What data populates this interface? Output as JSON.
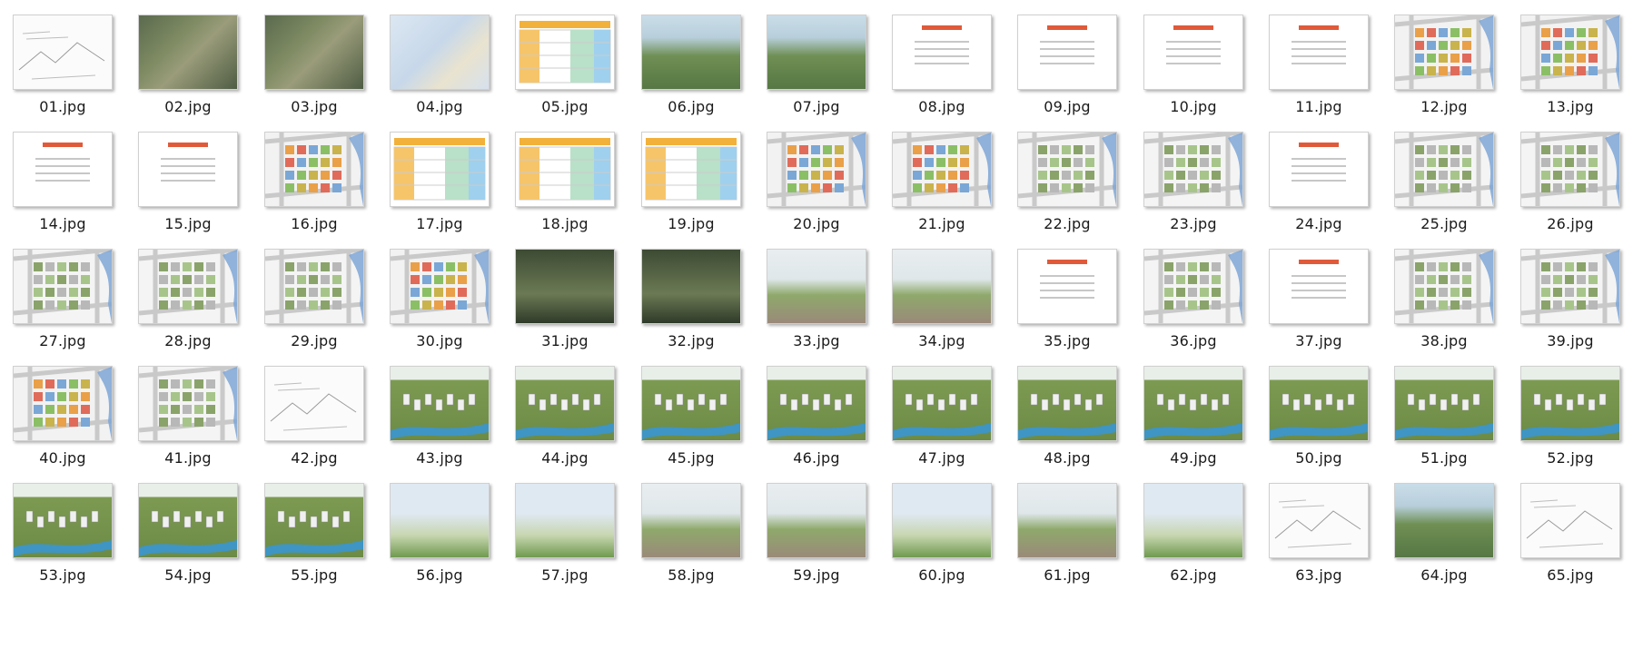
{
  "files": [
    {
      "name": "01.jpg",
      "kind": "sketch"
    },
    {
      "name": "02.jpg",
      "kind": "aerial"
    },
    {
      "name": "03.jpg",
      "kind": "aerial"
    },
    {
      "name": "04.jpg",
      "kind": "map"
    },
    {
      "name": "05.jpg",
      "kind": "table"
    },
    {
      "name": "06.jpg",
      "kind": "render"
    },
    {
      "name": "07.jpg",
      "kind": "render"
    },
    {
      "name": "08.jpg",
      "kind": "text"
    },
    {
      "name": "09.jpg",
      "kind": "text"
    },
    {
      "name": "10.jpg",
      "kind": "text"
    },
    {
      "name": "11.jpg",
      "kind": "text"
    },
    {
      "name": "12.jpg",
      "kind": "plan-color"
    },
    {
      "name": "13.jpg",
      "kind": "plan-color"
    },
    {
      "name": "14.jpg",
      "kind": "text"
    },
    {
      "name": "15.jpg",
      "kind": "text"
    },
    {
      "name": "16.jpg",
      "kind": "plan-color"
    },
    {
      "name": "17.jpg",
      "kind": "table"
    },
    {
      "name": "18.jpg",
      "kind": "table"
    },
    {
      "name": "19.jpg",
      "kind": "table"
    },
    {
      "name": "20.jpg",
      "kind": "plan-color"
    },
    {
      "name": "21.jpg",
      "kind": "plan-color"
    },
    {
      "name": "22.jpg",
      "kind": "plan"
    },
    {
      "name": "23.jpg",
      "kind": "plan"
    },
    {
      "name": "24.jpg",
      "kind": "text"
    },
    {
      "name": "25.jpg",
      "kind": "plan"
    },
    {
      "name": "26.jpg",
      "kind": "plan"
    },
    {
      "name": "27.jpg",
      "kind": "plan"
    },
    {
      "name": "28.jpg",
      "kind": "plan"
    },
    {
      "name": "29.jpg",
      "kind": "plan"
    },
    {
      "name": "30.jpg",
      "kind": "plan-color"
    },
    {
      "name": "31.jpg",
      "kind": "photo-dark"
    },
    {
      "name": "32.jpg",
      "kind": "photo-dark"
    },
    {
      "name": "33.jpg",
      "kind": "street"
    },
    {
      "name": "34.jpg",
      "kind": "street"
    },
    {
      "name": "35.jpg",
      "kind": "text"
    },
    {
      "name": "36.jpg",
      "kind": "plan"
    },
    {
      "name": "37.jpg",
      "kind": "text"
    },
    {
      "name": "38.jpg",
      "kind": "plan"
    },
    {
      "name": "39.jpg",
      "kind": "plan"
    },
    {
      "name": "40.jpg",
      "kind": "plan-color"
    },
    {
      "name": "41.jpg",
      "kind": "plan"
    },
    {
      "name": "42.jpg",
      "kind": "sketch"
    },
    {
      "name": "43.jpg",
      "kind": "3d"
    },
    {
      "name": "44.jpg",
      "kind": "3d"
    },
    {
      "name": "45.jpg",
      "kind": "3d"
    },
    {
      "name": "46.jpg",
      "kind": "3d"
    },
    {
      "name": "47.jpg",
      "kind": "3d"
    },
    {
      "name": "48.jpg",
      "kind": "3d"
    },
    {
      "name": "49.jpg",
      "kind": "3d"
    },
    {
      "name": "50.jpg",
      "kind": "3d"
    },
    {
      "name": "51.jpg",
      "kind": "3d"
    },
    {
      "name": "52.jpg",
      "kind": "3d"
    },
    {
      "name": "53.jpg",
      "kind": "3d"
    },
    {
      "name": "54.jpg",
      "kind": "3d"
    },
    {
      "name": "55.jpg",
      "kind": "3d"
    },
    {
      "name": "56.jpg",
      "kind": "tower"
    },
    {
      "name": "57.jpg",
      "kind": "tower"
    },
    {
      "name": "58.jpg",
      "kind": "street"
    },
    {
      "name": "59.jpg",
      "kind": "street"
    },
    {
      "name": "60.jpg",
      "kind": "tower"
    },
    {
      "name": "61.jpg",
      "kind": "street"
    },
    {
      "name": "62.jpg",
      "kind": "tower"
    },
    {
      "name": "63.jpg",
      "kind": "sketch"
    },
    {
      "name": "64.jpg",
      "kind": "render"
    },
    {
      "name": "65.jpg",
      "kind": "sketch"
    }
  ]
}
